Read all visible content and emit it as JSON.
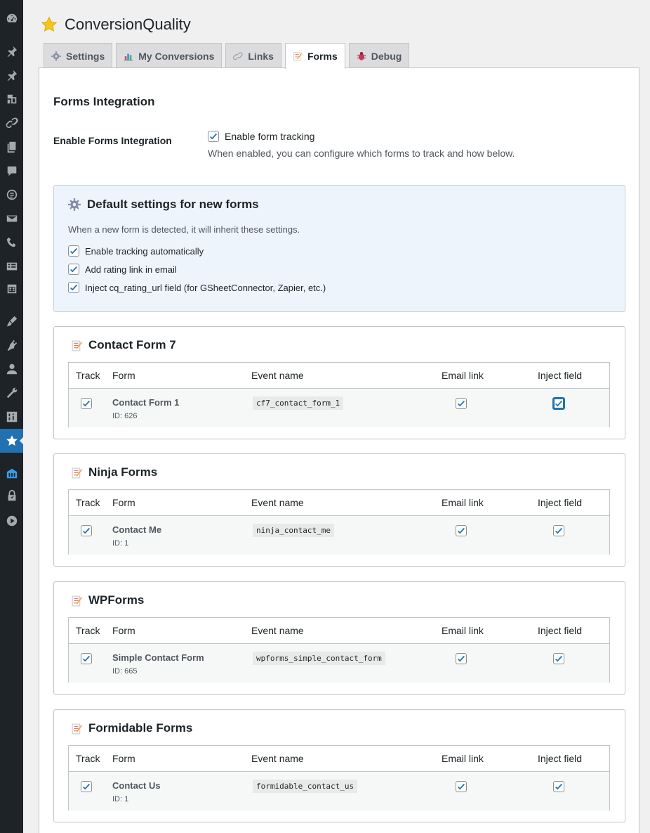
{
  "page": {
    "title": "ConversionQuality",
    "title_icon": "star-icon"
  },
  "sidebar": {
    "icons": [
      "dashboard-icon",
      "pin-icon",
      "pin-icon",
      "media-icon",
      "link-icon",
      "pages-icon",
      "comments-icon",
      "forms-plugin-icon",
      "email-icon",
      "phone-icon",
      "list-icon",
      "calendar-icon",
      "appearance-icon",
      "plugins-icon",
      "users-icon",
      "tools-icon",
      "settings-icon",
      "star-icon",
      "building-icon",
      "lock-icon",
      "play-icon"
    ],
    "active": "star-icon"
  },
  "tabs": [
    {
      "label": "Settings",
      "icon": "gear-icon",
      "active": false
    },
    {
      "label": "My Conversions",
      "icon": "bar-chart-icon",
      "active": false
    },
    {
      "label": "Links",
      "icon": "link-icon",
      "active": false
    },
    {
      "label": "Forms",
      "icon": "memo-icon",
      "active": true
    },
    {
      "label": "Debug",
      "icon": "bug-icon",
      "active": false
    }
  ],
  "forms_integration": {
    "heading": "Forms Integration",
    "enable_label": "Enable Forms Integration",
    "enable_checkbox_label": "Enable form tracking",
    "enable_checked": true,
    "enable_description": "When enabled, you can configure which forms to track and how below."
  },
  "defaults": {
    "title": "Default settings for new forms",
    "description": "When a new form is detected, it will inherit these settings.",
    "options": [
      {
        "label": "Enable tracking automatically",
        "checked": true
      },
      {
        "label": "Add rating link in email",
        "checked": true
      },
      {
        "label": "Inject cq_rating_url field (for GSheetConnector, Zapier, etc.)",
        "checked": true
      }
    ]
  },
  "table_headers": {
    "track": "Track",
    "form": "Form",
    "event": "Event name",
    "email": "Email link",
    "inject": "Inject field"
  },
  "plugins": [
    {
      "name": "Contact Form 7",
      "form": {
        "name": "Contact Form 1",
        "id": "ID: 626",
        "event": "cf7_contact_form_1",
        "track": true,
        "email": true,
        "inject": true
      }
    },
    {
      "name": "Ninja Forms",
      "form": {
        "name": "Contact Me",
        "id": "ID: 1",
        "event": "ninja_contact_me",
        "track": true,
        "email": true,
        "inject": true
      }
    },
    {
      "name": "WPForms",
      "form": {
        "name": "Simple Contact Form",
        "id": "ID: 665",
        "event": "wpforms_simple_contact_form",
        "track": true,
        "email": true,
        "inject": true
      }
    },
    {
      "name": "Formidable Forms",
      "form": {
        "name": "Contact Us",
        "id": "ID: 1",
        "event": "formidable_contact_us",
        "track": true,
        "email": true,
        "inject": true
      }
    }
  ],
  "colors": {
    "accent": "#2271b1",
    "sidebar": "#1d2327",
    "defaults_bg": "#eef4fb"
  }
}
